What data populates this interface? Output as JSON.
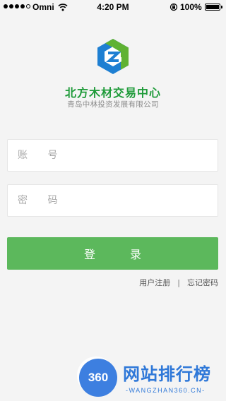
{
  "status_bar": {
    "carrier": "Omni",
    "time": "4:20 PM",
    "battery": "100%",
    "battery_level": 1.0,
    "signal_bars_filled": 4,
    "signal_bars_total": 5
  },
  "app": {
    "title": "北方木材交易中心",
    "subtitle": "青岛中林投资发展有限公司"
  },
  "form": {
    "account_placeholder": "账 号",
    "account_value": "",
    "password_placeholder": "密 码",
    "password_value": "",
    "login_label": "登 录"
  },
  "links": {
    "register": "用户注册",
    "separator": "|",
    "forgot": "忘记密码"
  },
  "watermark": {
    "badge": "360",
    "name": "网站排行榜",
    "domain": "-WANGZHAN360.CN-"
  },
  "colors": {
    "brand_green": "#1f9b3a",
    "button_green": "#5cb85c",
    "logo_blue": "#1e7fd2",
    "logo_green": "#5fb233",
    "watermark_blue": "#2f78d8"
  },
  "icons": {
    "wifi": "wifi-icon",
    "orientation_lock": "orientation-lock-icon",
    "battery": "battery-icon",
    "logo": "hexagon-logo-icon"
  }
}
